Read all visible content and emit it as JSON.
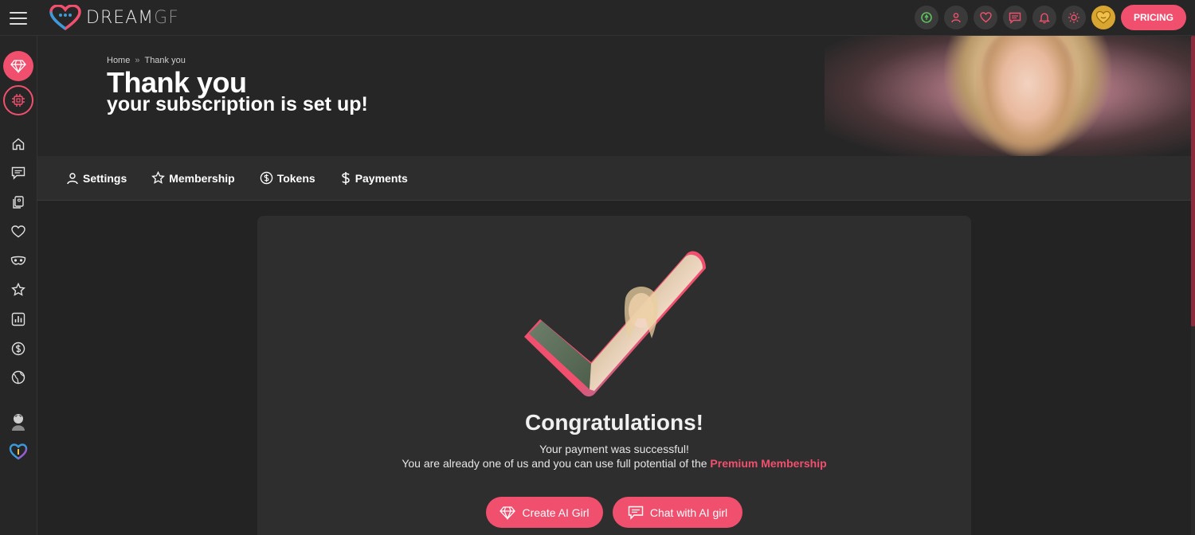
{
  "app": {
    "logo_text_main": "DREAM",
    "logo_text_accent": "GF"
  },
  "header": {
    "icons": [
      "rocket-coin-icon",
      "user-icon",
      "heart-icon",
      "chat-icon",
      "bell-icon",
      "sun-icon",
      "coin-heart-icon"
    ],
    "pricing_label": "PRICING"
  },
  "sidebar": {
    "top_buttons": [
      "diamond-icon",
      "chip-icon"
    ],
    "items": [
      "home-icon",
      "chat-icon",
      "gallery-icon",
      "heart-icon",
      "mask-icon",
      "star-icon",
      "stats-icon",
      "dollar-icon",
      "globe-icon",
      "avatar-icon",
      "logo-heart-icon"
    ]
  },
  "banner": {
    "breadcrumb": {
      "home": "Home",
      "separator": "»",
      "current": "Thank you"
    },
    "title": "Thank you",
    "subtitle": "your subscription is set up!"
  },
  "tabs": [
    {
      "label": "Settings",
      "icon": "user-icon"
    },
    {
      "label": "Membership",
      "icon": "star-icon"
    },
    {
      "label": "Tokens",
      "icon": "coin-icon"
    },
    {
      "label": "Payments",
      "icon": "dollar-icon"
    }
  ],
  "main": {
    "heading": "Congratulations!",
    "line1": "Your payment was successful!",
    "line2_prefix": "You are already one of us and you can use full potential of the ",
    "line2_highlight": "Premium Membership",
    "buttons": {
      "create": "Create AI Girl",
      "chat": "Chat with AI girl"
    }
  },
  "colors": {
    "accent": "#f0506e",
    "background": "#232323",
    "panel": "#2e2e2e"
  }
}
